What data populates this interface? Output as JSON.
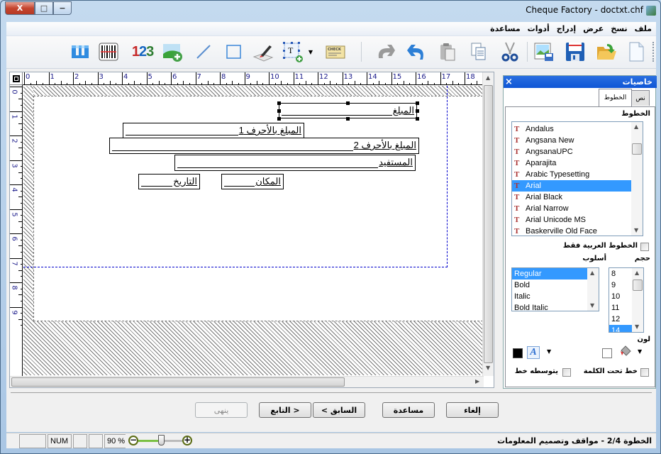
{
  "window": {
    "title": "Cheque Factory - doctxt.chf",
    "caption_buttons": {
      "close": "X",
      "maximize": "□",
      "minimize": "−"
    }
  },
  "menu": {
    "items": [
      "ملف",
      "نسخ",
      "عرض",
      "إدراج",
      "أدوات",
      "مساعدة"
    ]
  },
  "toolbar": {
    "left_tools": [
      "text-style-icon",
      "barcode-icon",
      "number-icon",
      "insert-image-icon",
      "line-icon",
      "rectangle-icon",
      "signature-icon",
      "insert-textbox-icon",
      "cheque-template-icon"
    ],
    "right_tools": [
      "redo-icon",
      "undo-icon",
      "paste-icon",
      "copy-icon",
      "cut-icon",
      "save-image-icon",
      "save-icon",
      "open-icon",
      "new-icon"
    ],
    "number_label": "123",
    "textbox_label": "T",
    "cheque_label": "CHECK"
  },
  "rulers": {
    "horizontal": [
      "0",
      "1",
      "2",
      "3",
      "4",
      "5",
      "6",
      "7",
      "8",
      "9",
      "10",
      "11",
      "12",
      "13",
      "14",
      "15",
      "16",
      "17",
      "18"
    ],
    "vertical": [
      "0",
      "1",
      "2",
      "3",
      "4",
      "5",
      "6",
      "7",
      "8",
      "9"
    ]
  },
  "canvas": {
    "fields": [
      {
        "id": "amount",
        "label": "المبلغ",
        "selected": true
      },
      {
        "id": "amount-words-1",
        "label": "المبلغ بالأحرف 1",
        "selected": false
      },
      {
        "id": "amount-words-2",
        "label": "المبلغ بالأحرف 2",
        "selected": false
      },
      {
        "id": "beneficiary",
        "label": "المستفيد",
        "selected": false
      },
      {
        "id": "place",
        "label": "المكان",
        "selected": false
      },
      {
        "id": "date",
        "label": "التاريخ",
        "selected": false
      }
    ]
  },
  "properties": {
    "title": "خاصيات",
    "close": "×",
    "tabs": [
      {
        "label": "نص",
        "active": false
      },
      {
        "label": "الخطوط",
        "active": true
      }
    ],
    "fonts_label": "الخطوط",
    "fonts": [
      "Andalus",
      "Angsana New",
      "AngsanaUPC",
      "Aparajita",
      "Arabic Typesetting",
      "Arial",
      "Arial Black",
      "Arial Narrow",
      "Arial Unicode MS",
      "Baskerville Old Face"
    ],
    "selected_font": "Arial",
    "arabic_only_label": "الخطوط العربية فقط",
    "arabic_only_checked": false,
    "style_label": "أسلوب",
    "styles": [
      "Regular",
      "Bold",
      "Italic",
      "Bold Italic"
    ],
    "selected_style": "Regular",
    "size_label": "حجم",
    "sizes": [
      "8",
      "9",
      "10",
      "11",
      "12",
      "14"
    ],
    "selected_size": "14",
    "color_label": "لون",
    "text_color": "#000000",
    "fill_color": "#ffffff",
    "underline_label": "خط تحت الكلمة",
    "underline_checked": false,
    "strikeout_label": "يتوسطه خط",
    "strikeout_checked": false
  },
  "wizard_buttons": {
    "finish": "ينهى",
    "next": "التابع >",
    "back": "< السابق",
    "help": "مساعدة",
    "cancel": "إلغاء"
  },
  "statusbar": {
    "num": "NUM",
    "zoom": "90 %",
    "zoom_value_percent": 90,
    "step_text": "الخطوة 2/4 - مواقف وتصميم المعلومات"
  },
  "colors": {
    "panel_title_bg": "#0f56d6",
    "selection": "#3399ff",
    "ruler_text": "#1a1a8a",
    "margin_guide": "#0000cc"
  }
}
